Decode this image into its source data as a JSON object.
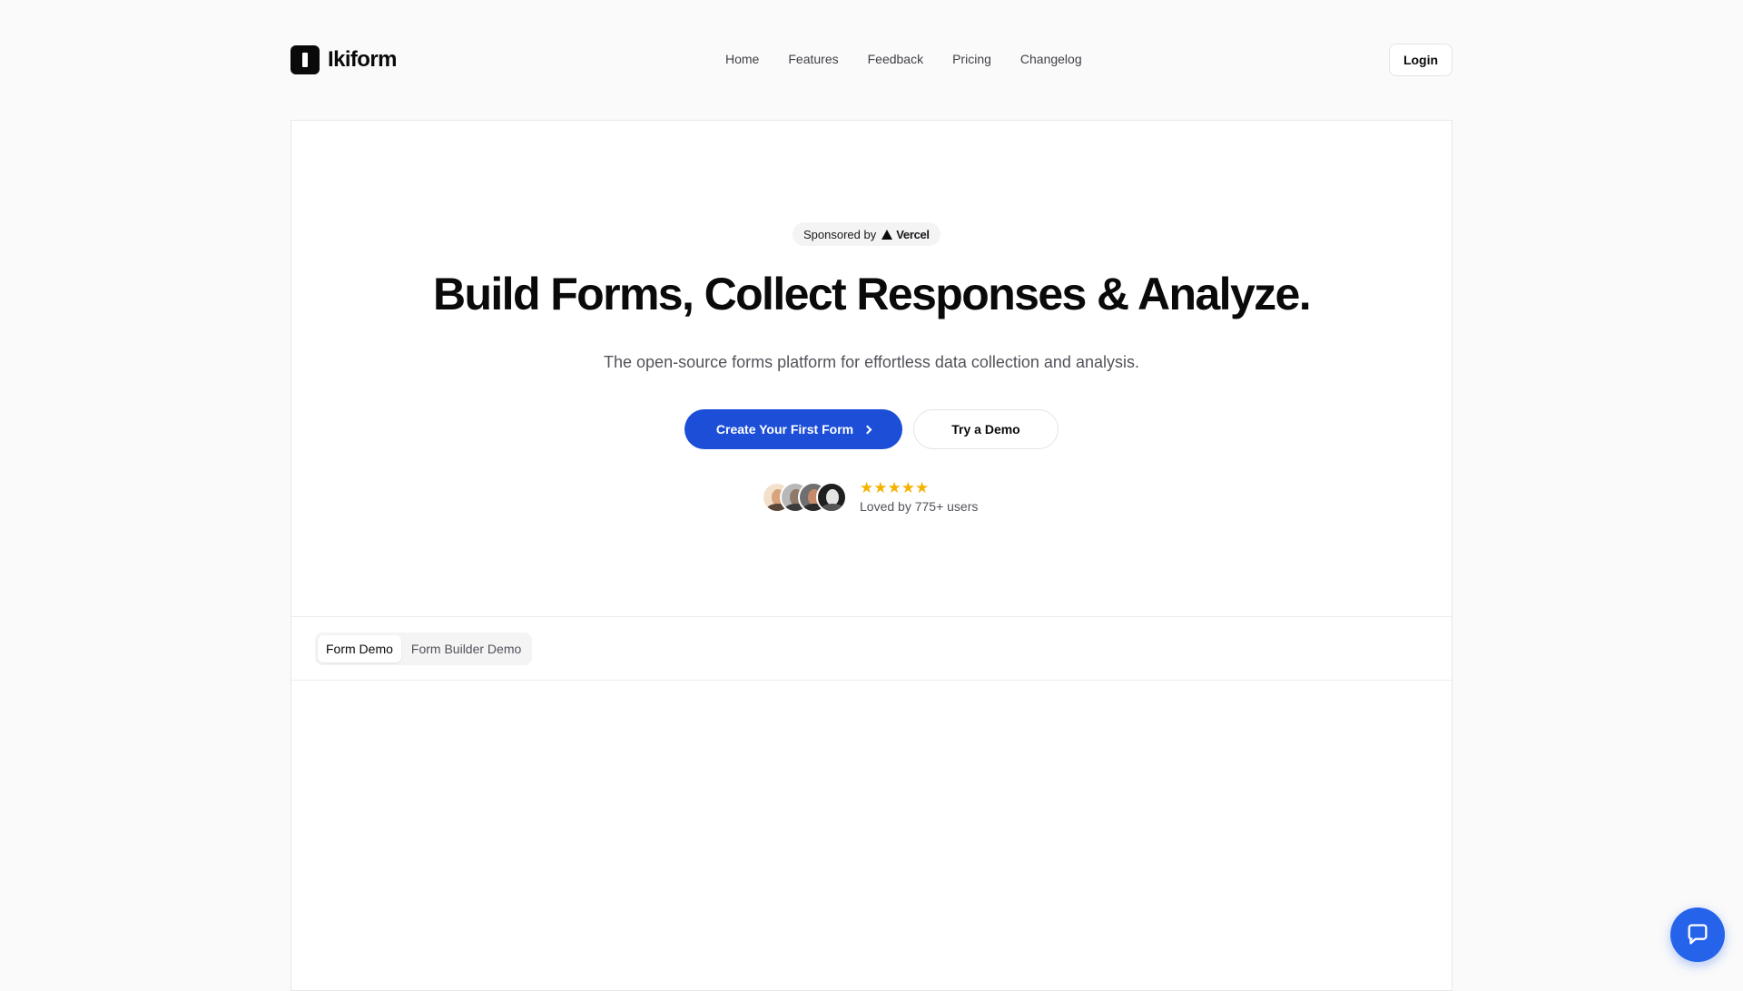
{
  "header": {
    "brand_name": "Ikiform",
    "nav": [
      {
        "label": "Home"
      },
      {
        "label": "Features"
      },
      {
        "label": "Feedback"
      },
      {
        "label": "Pricing"
      },
      {
        "label": "Changelog"
      }
    ],
    "login_label": "Login"
  },
  "hero": {
    "sponsor_prefix": "Sponsored by",
    "sponsor_name": "Vercel",
    "headline": "Build Forms, Collect Responses & Analyze.",
    "subline": "The open-source forms platform for effortless data collection and analysis.",
    "primary_cta": "Create Your First Form",
    "secondary_cta": "Try a Demo",
    "rating_stars": 5,
    "stars_text": "★★★★★",
    "loved_text": "Loved by 775+ users"
  },
  "demo": {
    "tabs": [
      {
        "label": "Form Demo",
        "active": true
      },
      {
        "label": "Form Builder Demo",
        "active": false
      }
    ]
  },
  "colors": {
    "accent": "#1d4ed8",
    "chat_fab": "#2563eb",
    "star": "#f5b301"
  },
  "icons": {
    "brand": "ikiform-logo",
    "sponsor": "vercel-triangle-icon",
    "cta": "chevron-right-icon",
    "chat": "chat-bubble-icon"
  }
}
